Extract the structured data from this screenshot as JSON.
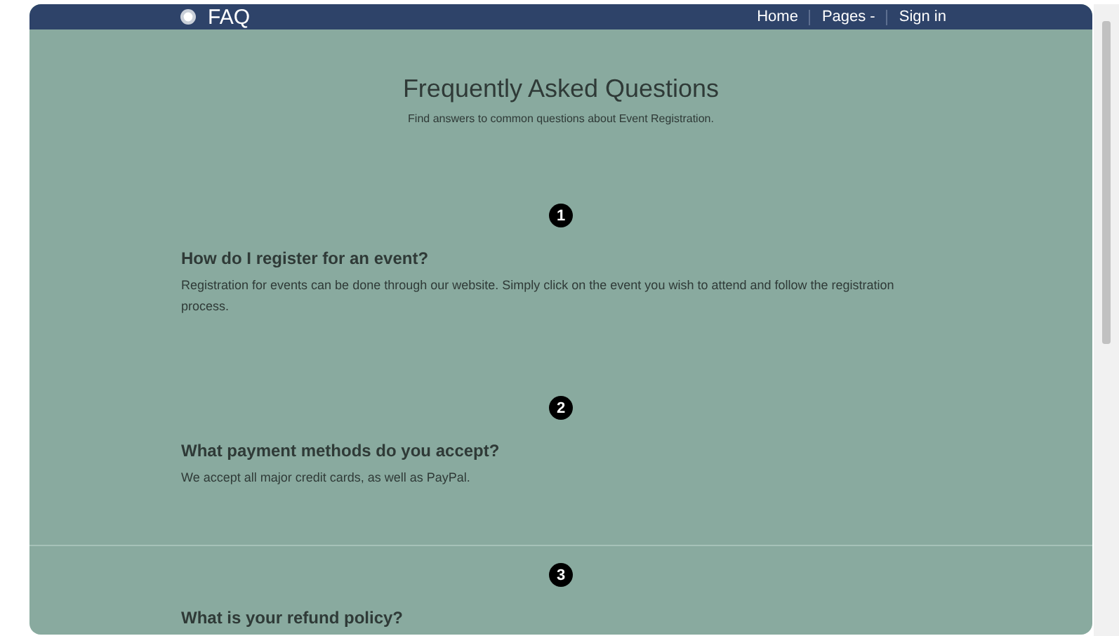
{
  "navbar": {
    "brand": "FAQ",
    "links": [
      {
        "label": "Home"
      },
      {
        "label": "Pages -"
      },
      {
        "label": "Sign in"
      }
    ]
  },
  "header": {
    "title": "Frequently Asked Questions",
    "subtitle": "Find answers to common questions about Event Registration."
  },
  "faqs": [
    {
      "number": "1",
      "question": "How do I register for an event?",
      "answer": "Registration for events can be done through our website. Simply click on the event you wish to attend and follow the registration process."
    },
    {
      "number": "2",
      "question": "What payment methods do you accept?",
      "answer": "We accept all major credit cards, as well as PayPal."
    },
    {
      "number": "3",
      "question": "What is your refund policy?"
    }
  ]
}
